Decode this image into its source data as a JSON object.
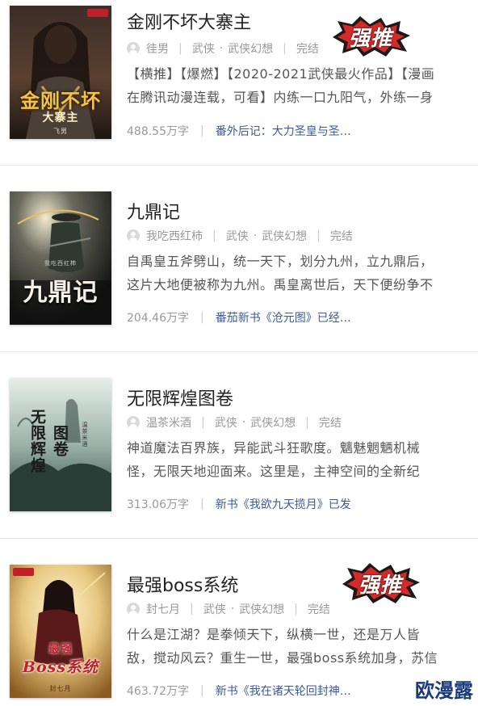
{
  "books": [
    {
      "title": "金刚不坏大寨主",
      "author": "徍男",
      "genre": "武侠",
      "subgenre": "武侠幻想",
      "status": "完结",
      "desc_line1": "【横推】【爆燃】【2020-2021武侠最火作品】【漫画",
      "desc_line2": "在腾讯动漫连载，可看】内练一口九阳气，外练一身",
      "word_count": "488.55万字",
      "chapter": "番外后记：大力圣皇与圣…",
      "badge": "强推",
      "cover_text_1": "金刚不坏",
      "cover_text_2": "大寨主",
      "cover_author": "飞男",
      "cover_colors": [
        "#2b2420",
        "#6e4a2a",
        "#c9a04a"
      ]
    },
    {
      "title": "九鼎记",
      "author": "我吃西红柿",
      "genre": "武侠",
      "subgenre": "武侠幻想",
      "status": "完结",
      "desc_line1": "自禹皇五斧劈山，统一天下，划分九州，立九鼎后，",
      "desc_line2": "这片大地便被称为九州。禹皇离世后，天下便纷争不",
      "word_count": "204.46万字",
      "chapter": "番茄新书《沧元图》已经…",
      "badge": "",
      "cover_text_1": "九鼎记",
      "cover_text_2": "",
      "cover_author": "我吃西红柿",
      "cover_colors": [
        "#1e1e1e",
        "#4a4a42",
        "#e8d9b0"
      ]
    },
    {
      "title": "无限辉煌图卷",
      "author": "温茶米酒",
      "genre": "武侠",
      "subgenre": "武侠幻想",
      "status": "完结",
      "desc_line1": "神道魔法百界族，异能武斗狂歌度。魑魅魍魉机械",
      "desc_line2": "怪，无限天地迎面来。这里是，主神空间的全新纪",
      "word_count": "313.06万字",
      "chapter": "新书《我欲九天揽月》已发",
      "badge": "",
      "cover_text_1": "无限辉煌",
      "cover_text_2": "图卷",
      "cover_author": "温茶米酒",
      "cover_colors": [
        "#8fa8a0",
        "#3e5a55",
        "#e4ece6"
      ]
    },
    {
      "title": "最强boss系统",
      "author": "封七月",
      "genre": "武侠",
      "subgenre": "武侠幻想",
      "status": "完结",
      "desc_line1": "什么是江湖？是拳倾天下，纵横一世，还是万人皆",
      "desc_line2": "敌，搅动风云？重生一世，最强boss系统加身，苏信",
      "word_count": "463.72万字",
      "chapter": "新书《我在诸天轮回封神…",
      "badge": "强推",
      "cover_text_1": "最强",
      "cover_text_2": "Boss系统",
      "cover_author": "封七月",
      "cover_colors": [
        "#f2e6c8",
        "#b8862a",
        "#c0202a"
      ]
    }
  ],
  "watermark": "欧漫露",
  "colors": {
    "title": "#222222",
    "meta": "#999999",
    "link": "#3a5a9a",
    "badge": "#d42a2a"
  }
}
